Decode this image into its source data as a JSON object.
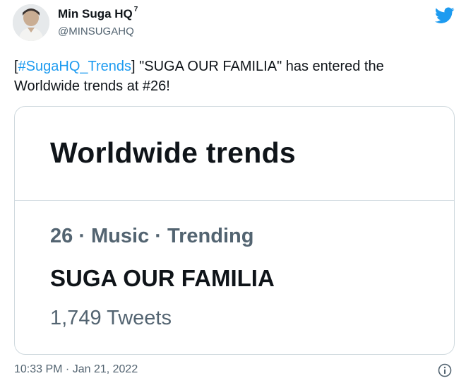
{
  "author": {
    "name": "Min Suga HQ",
    "name_sup": "7",
    "handle": "@MINSUGAHQ"
  },
  "tweet": {
    "hashtag_open": "[",
    "hashtag": "#SugaHQ_Trends",
    "hashtag_close": "]",
    "body": " \"SUGA OUR FAMILIA\" has entered the Worldwide trends at #26!"
  },
  "card": {
    "title": "Worldwide trends",
    "meta": "26 · Music · Trending",
    "trend": "SUGA OUR FAMILIA",
    "count": "1,749 Tweets"
  },
  "footer": {
    "timestamp": "10:33 PM · Jan 21, 2022"
  },
  "icons": {
    "platform": "twitter-bird-icon",
    "info": "info-icon"
  },
  "colors": {
    "accent": "#1d9bf0",
    "text": "#0f1419",
    "secondary": "#536471",
    "border": "#cfd9de"
  }
}
